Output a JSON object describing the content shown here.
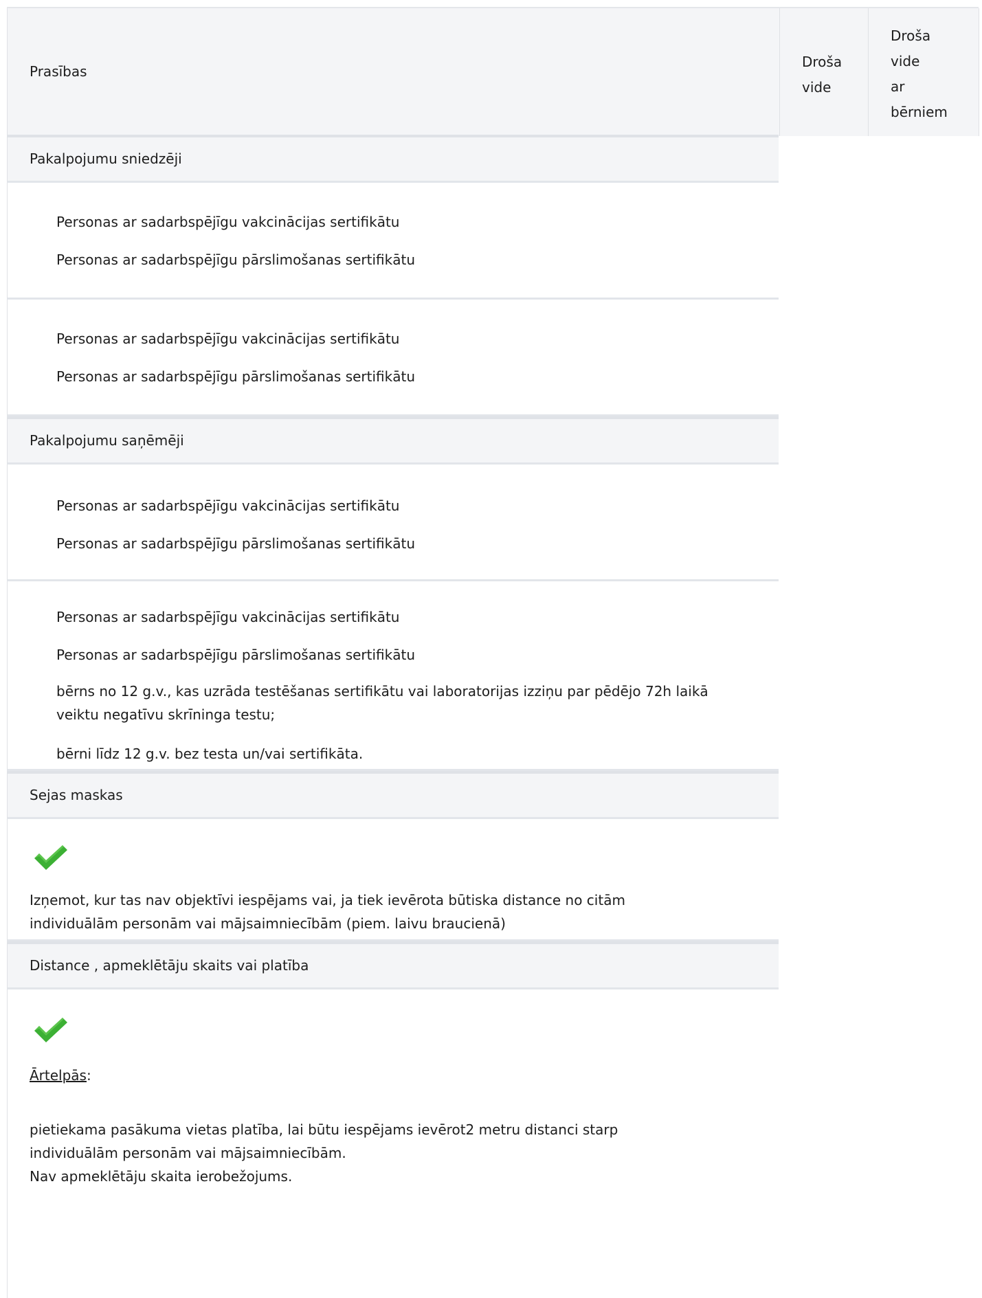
{
  "header": {
    "col_requirements": "Prasības",
    "col_safe_env": [
      "Droša",
      "vide"
    ],
    "col_safe_env_children": [
      "Droša",
      "vide",
      "ar",
      "bērniem"
    ]
  },
  "sections": {
    "providers": {
      "title": "Pakalpojumu sniedzēji",
      "block1": [
        "Personas ar sadarbspējīgu vakcinācijas sertifikātu",
        "Personas ar sadarbspējīgu pārslimošanas sertifikātu"
      ],
      "block2": [
        "Personas ar sadarbspējīgu vakcinācijas sertifikātu",
        "Personas ar sadarbspējīgu pārslimošanas sertifikātu"
      ]
    },
    "recipients": {
      "title": "Pakalpojumu saņēmēji",
      "block1": [
        "Personas ar sadarbspējīgu vakcinācijas sertifikātu",
        "Personas ar sadarbspējīgu pārslimošanas sertifikātu"
      ],
      "block2": [
        "Personas ar sadarbspējīgu vakcinācijas sertifikātu",
        "Personas ar sadarbspējīgu pārslimošanas sertifikātu"
      ],
      "child_note_lines": [
        "bērns no 12 g.v., kas uzrāda testēšanas sertifikātu vai laboratorijas izziņu par pēdējo 72h laikā",
        "veiktu negatīvu skrīninga testu;"
      ],
      "child_under_12": "bērni līdz 12 g.v. bez testa un/vai sertifikāta."
    },
    "masks": {
      "title": "Sejas maskas",
      "icon": "check-icon",
      "note_lines": [
        "Izņemot, kur tas nav objektīvi iespējams vai, ja tiek ievērota būtiska distance no citām",
        "individuālām personām vai mājsaimniecībām (piem. laivu braucienā)"
      ]
    },
    "distance": {
      "title": "Distance , apmeklētāju skaits vai platība",
      "icon": "check-icon",
      "outdoor_label": "Ārtelpās",
      "outdoor_colon": ":",
      "text_lines": [
        "pietiekama pasākuma vietas platība, lai būtu iespējams ievērot2 metru distanci starp",
        "individuālām personām vai mājsaimniecībām.",
        "Nav apmeklētāju skaita ierobežojums."
      ]
    }
  },
  "colors": {
    "check": "#3cb034",
    "header_bg": "#f4f5f7",
    "divider": "#e2e5ea"
  }
}
